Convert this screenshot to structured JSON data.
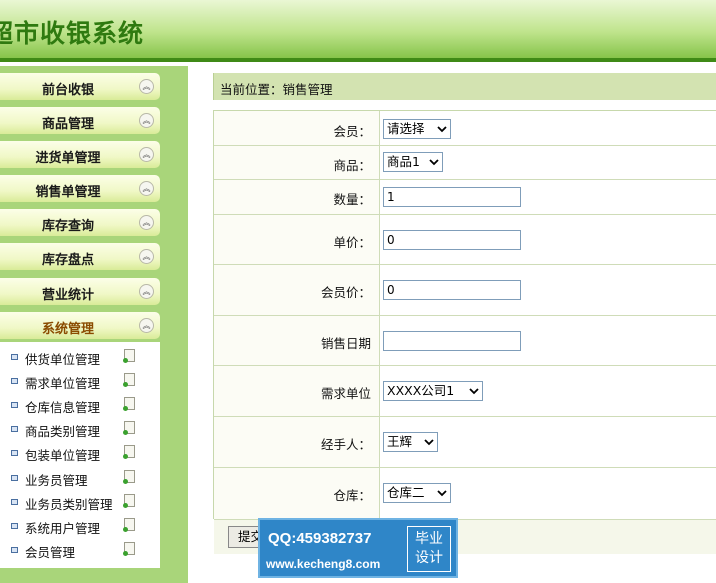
{
  "app": {
    "title": "超市收银系统"
  },
  "sidebar": {
    "menu": [
      {
        "label": "前台收银"
      },
      {
        "label": "商品管理"
      },
      {
        "label": "进货单管理"
      },
      {
        "label": "销售单管理"
      },
      {
        "label": "库存查询"
      },
      {
        "label": "库存盘点"
      },
      {
        "label": "营业统计"
      },
      {
        "label": "系统管理"
      }
    ],
    "submenu": [
      {
        "label": "供货单位管理"
      },
      {
        "label": "需求单位管理"
      },
      {
        "label": "仓库信息管理"
      },
      {
        "label": "商品类别管理"
      },
      {
        "label": "包装单位管理"
      },
      {
        "label": "业务员管理"
      },
      {
        "label": "业务员类别管理"
      },
      {
        "label": "系统用户管理"
      },
      {
        "label": "会员管理"
      }
    ]
  },
  "breadcrumb": "当前位置：销售管理",
  "form": {
    "member": {
      "label": "会员：",
      "value": "请选择"
    },
    "product": {
      "label": "商品：",
      "value": "商品1"
    },
    "quantity": {
      "label": "数量：",
      "value": "1"
    },
    "unit_price": {
      "label": "单价：",
      "value": "0"
    },
    "member_price": {
      "label": "会员价：",
      "value": "0"
    },
    "sale_date": {
      "label": "销售日期",
      "value": ""
    },
    "demand_unit": {
      "label": "需求单位",
      "value": "XXXX公司1"
    },
    "handler": {
      "label": "经手人：",
      "value": "王辉"
    },
    "warehouse": {
      "label": "仓库：",
      "value": "仓库二"
    },
    "submit_label": "提交"
  },
  "watermark": {
    "qq": "QQ:459382737",
    "site": "www.kecheng8.com",
    "badge_line1": "毕业",
    "badge_line2": "设计"
  }
}
